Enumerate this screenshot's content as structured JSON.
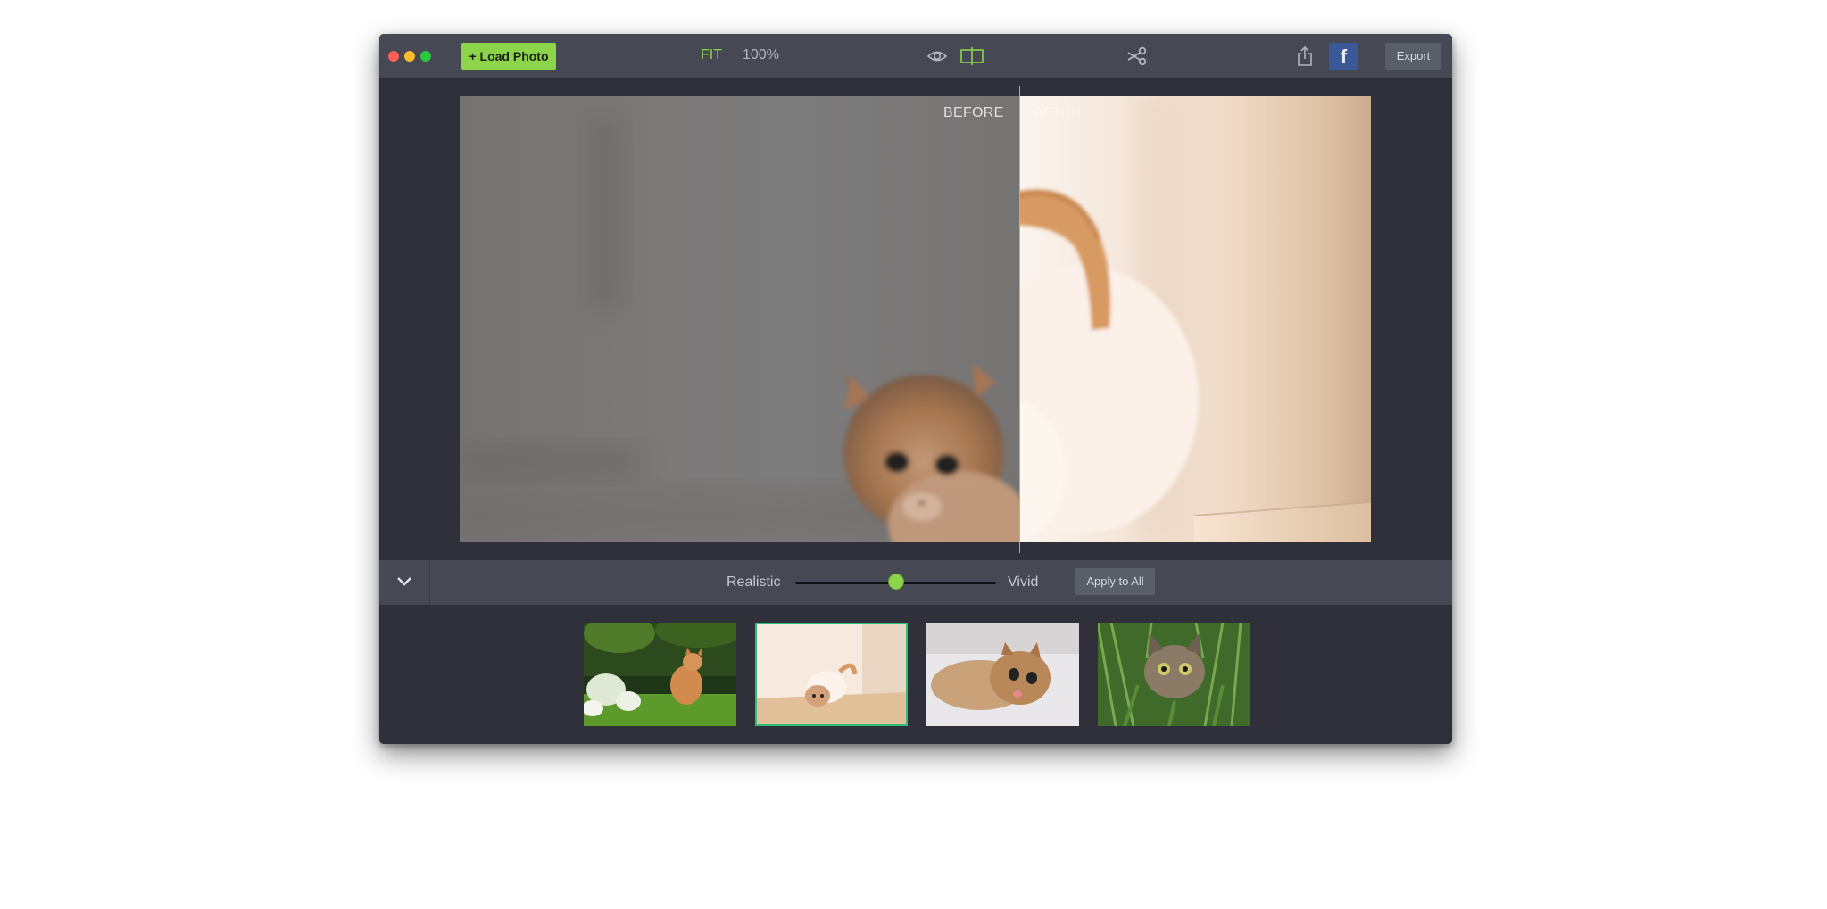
{
  "toolbar": {
    "load_label": "+ Load Photo",
    "fit_label": "FIT",
    "zoom_label": "100%",
    "facebook_glyph": "f",
    "export_label": "Export",
    "icons": [
      "eye-icon",
      "compare-icon",
      "scissors-icon",
      "share-icon",
      "facebook-icon"
    ]
  },
  "canvas": {
    "before_label": "BEFORE",
    "after_label": "AFTER",
    "split_position": 0.615
  },
  "controls": {
    "left_label": "Realistic",
    "right_label": "Vivid",
    "slider_value": 0.5,
    "apply_label": "Apply to All"
  },
  "filmstrip": {
    "selected_index": 1,
    "count": 4
  },
  "colors": {
    "accent": "#8cd44a",
    "selection": "#2fbd78",
    "facebook": "#3b5998",
    "toolbar_bg": "#464954",
    "window_bg": "#2f3039"
  }
}
